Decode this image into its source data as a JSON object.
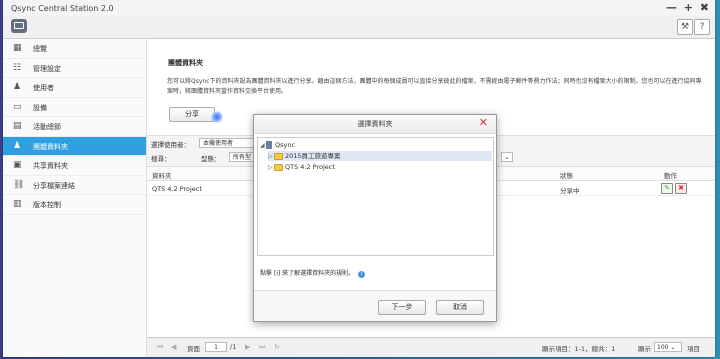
{
  "window": {
    "title": "Qsync Central Station 2.0"
  },
  "winctl": {
    "minimize": "—",
    "maximize": "+",
    "close": "✖"
  },
  "sidebar": {
    "items": [
      {
        "label": "總覽"
      },
      {
        "label": "管理設定"
      },
      {
        "label": "使用者"
      },
      {
        "label": "設備"
      },
      {
        "label": "活動總節"
      },
      {
        "label": "團體資料夾"
      },
      {
        "label": "共享資料夾"
      },
      {
        "label": "分享檔案連結"
      },
      {
        "label": "版本控制"
      }
    ]
  },
  "main": {
    "title": "團體資料夾",
    "description": "您可以將Qsync下的資料夾設為團體資料夾以進行分享。藉由這個方法，團體中的每個成員可以直接分享彼此的檔案，不需經由電子郵件等費力作法；同時也沒有檔案大小的限制。您也可以在進行協同專案時，將團體資料夾當作資料交換平台使用。",
    "share_button": "分享",
    "filter": {
      "user_label": "選擇使用者：",
      "user_value": "本機使用者",
      "search_label": "搜尋：",
      "type_label": "型態：",
      "type_value": "所有型"
    },
    "table": {
      "headers": {
        "folder": "資料夾",
        "status": "狀態",
        "action": "動作"
      },
      "rows": [
        {
          "folder": "QTS 4.2 Project",
          "status": "分享中"
        }
      ]
    }
  },
  "statusbar": {
    "page_label": "頁面",
    "page_value": "1",
    "page_total": "/1",
    "display_text": "顯示項目：1-1，總共：1",
    "display_label": "顯示",
    "per_page": "100",
    "items_label": "項目"
  },
  "dialog": {
    "title": "選擇資料夾",
    "tree": {
      "root": "Qsync",
      "children": [
        {
          "label": "2015員工旅遊專案"
        },
        {
          "label": "QTS 4.2 Project"
        }
      ]
    },
    "hint": "點擊 [i] 來了解選擇資料夾的規則。",
    "next_button": "下一步",
    "cancel_button": "取消"
  }
}
